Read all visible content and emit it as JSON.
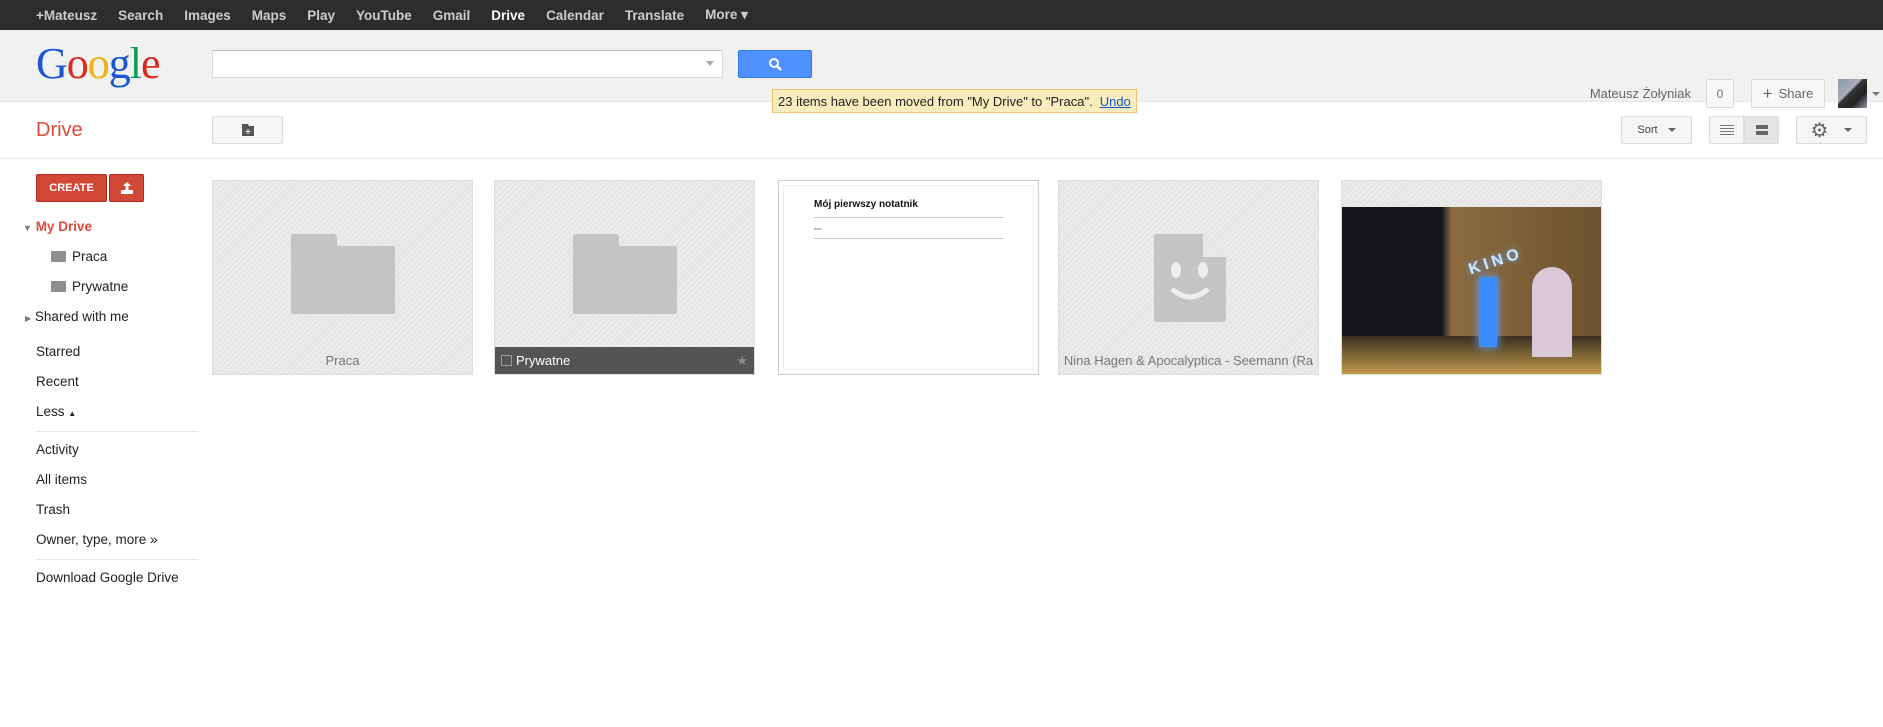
{
  "topbar": {
    "items": [
      "+Mateusz",
      "Search",
      "Images",
      "Maps",
      "Play",
      "YouTube",
      "Gmail",
      "Drive",
      "Calendar",
      "Translate",
      "More"
    ],
    "active": "Drive"
  },
  "header": {
    "logo": "Google",
    "search_value": "",
    "user_name": "Mateusz Żołyniak",
    "notifications": "0",
    "share_label": "Share"
  },
  "toast": {
    "message": "23 items have been moved from \"My Drive\" to \"Praca\".",
    "undo": "Undo"
  },
  "app": {
    "title": "Drive"
  },
  "toolbar": {
    "sort": "Sort"
  },
  "sidebar": {
    "create": "CREATE",
    "my_drive": "My Drive",
    "folders": [
      "Praca",
      "Prywatne"
    ],
    "shared": "Shared with me",
    "group1": [
      "Starred",
      "Recent"
    ],
    "less": "Less",
    "group2": [
      "Activity",
      "All items",
      "Trash",
      "Owner, type, more »"
    ],
    "download": "Download Google Drive"
  },
  "files": [
    {
      "name": "Praca",
      "type": "folder"
    },
    {
      "name": "Prywatne",
      "type": "folder",
      "selected": true
    },
    {
      "name": "Mój pierwszy notatnik",
      "type": "document",
      "preview_line": "data"
    },
    {
      "name": "Nina Hagen & Apocalyptica - Seemann (Ra",
      "type": "audio"
    },
    {
      "name": "KINO",
      "type": "image"
    }
  ],
  "colors": {
    "accent": "#dd4b39",
    "search_button": "#4d90fe",
    "topbar": "#2d2d2d"
  }
}
